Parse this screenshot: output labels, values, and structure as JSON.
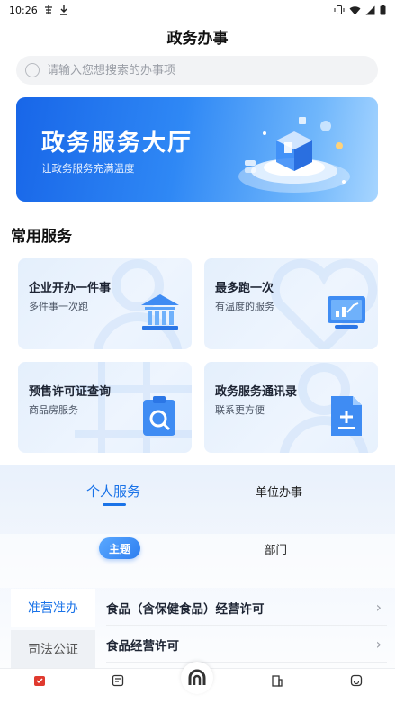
{
  "status_bar": {
    "time": "10:26"
  },
  "header": {
    "title": "政务办事"
  },
  "search": {
    "placeholder": "请输入您想搜索的办事项"
  },
  "banner": {
    "title": "政务服务大厅",
    "subtitle": "让政务服务充满温度"
  },
  "common_services": {
    "title": "常用服务",
    "cards": [
      {
        "title": "企业开办一件事",
        "subtitle": "多件事一次跑",
        "icon": "bank-building-icon"
      },
      {
        "title": "最多跑一次",
        "subtitle": "有温度的服务",
        "icon": "chart-monitor-icon"
      },
      {
        "title": "预售许可证查询",
        "subtitle": "商品房服务",
        "icon": "clipboard-search-icon"
      },
      {
        "title": "政务服务通讯录",
        "subtitle": "联系更方便",
        "icon": "document-plus-icon"
      }
    ]
  },
  "service_tabs": {
    "personal": "个人服务",
    "unit": "单位办事",
    "active": "personal"
  },
  "sub_tabs": {
    "topic": "主题",
    "department": "部门",
    "active": "topic"
  },
  "categories": [
    {
      "label": "准营准办",
      "active": true
    },
    {
      "label": "司法公证",
      "active": false
    }
  ],
  "items": [
    {
      "label": "食品（含保健食品）经营许可"
    },
    {
      "label": "食品经营许可"
    }
  ],
  "colors": {
    "accent": "#1a73e8",
    "nav_active": "#e03a2f"
  }
}
